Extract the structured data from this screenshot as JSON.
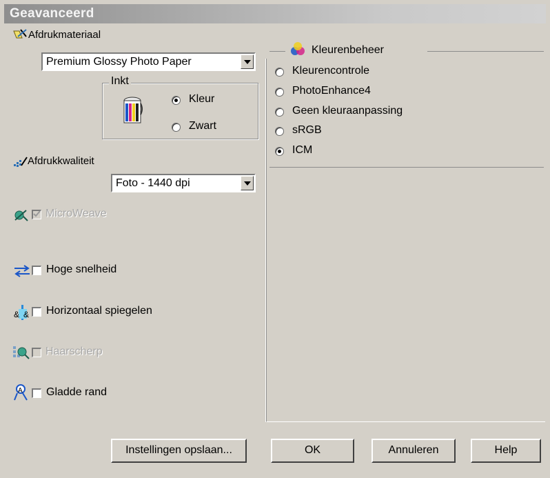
{
  "window": {
    "title": "Geavanceerd"
  },
  "left": {
    "media_label": "Afdrukmateriaal",
    "media_value": "Premium Glossy Photo Paper",
    "ink_group": "Inkt",
    "ink_color": "Kleur",
    "ink_black": "Zwart",
    "ink_selected": "Kleur",
    "quality_label": "Afdrukkwaliteit",
    "quality_value": "Foto - 1440 dpi",
    "microweave": "MicroWeave",
    "microweave_checked": true,
    "microweave_enabled": false,
    "high_speed": "Hoge snelheid",
    "high_speed_checked": false,
    "flip": "Horizontaal spiegelen",
    "flip_checked": false,
    "finest": "Haarscherp",
    "finest_checked": false,
    "finest_enabled": false,
    "smooth": "Gladde rand",
    "smooth_checked": false
  },
  "color_mgmt": {
    "title": "Kleurenbeheer",
    "options": [
      "Kleurencontrole",
      "PhotoEnhance4",
      "Geen kleuraanpassing",
      "sRGB",
      "ICM"
    ],
    "selected": "ICM"
  },
  "buttons": {
    "save": "Instellingen opslaan...",
    "ok": "OK",
    "cancel": "Annuleren",
    "help": "Help"
  },
  "colors": {
    "dialog": "#d4d0c8",
    "title_gradient_start": "#8e8e8e"
  }
}
